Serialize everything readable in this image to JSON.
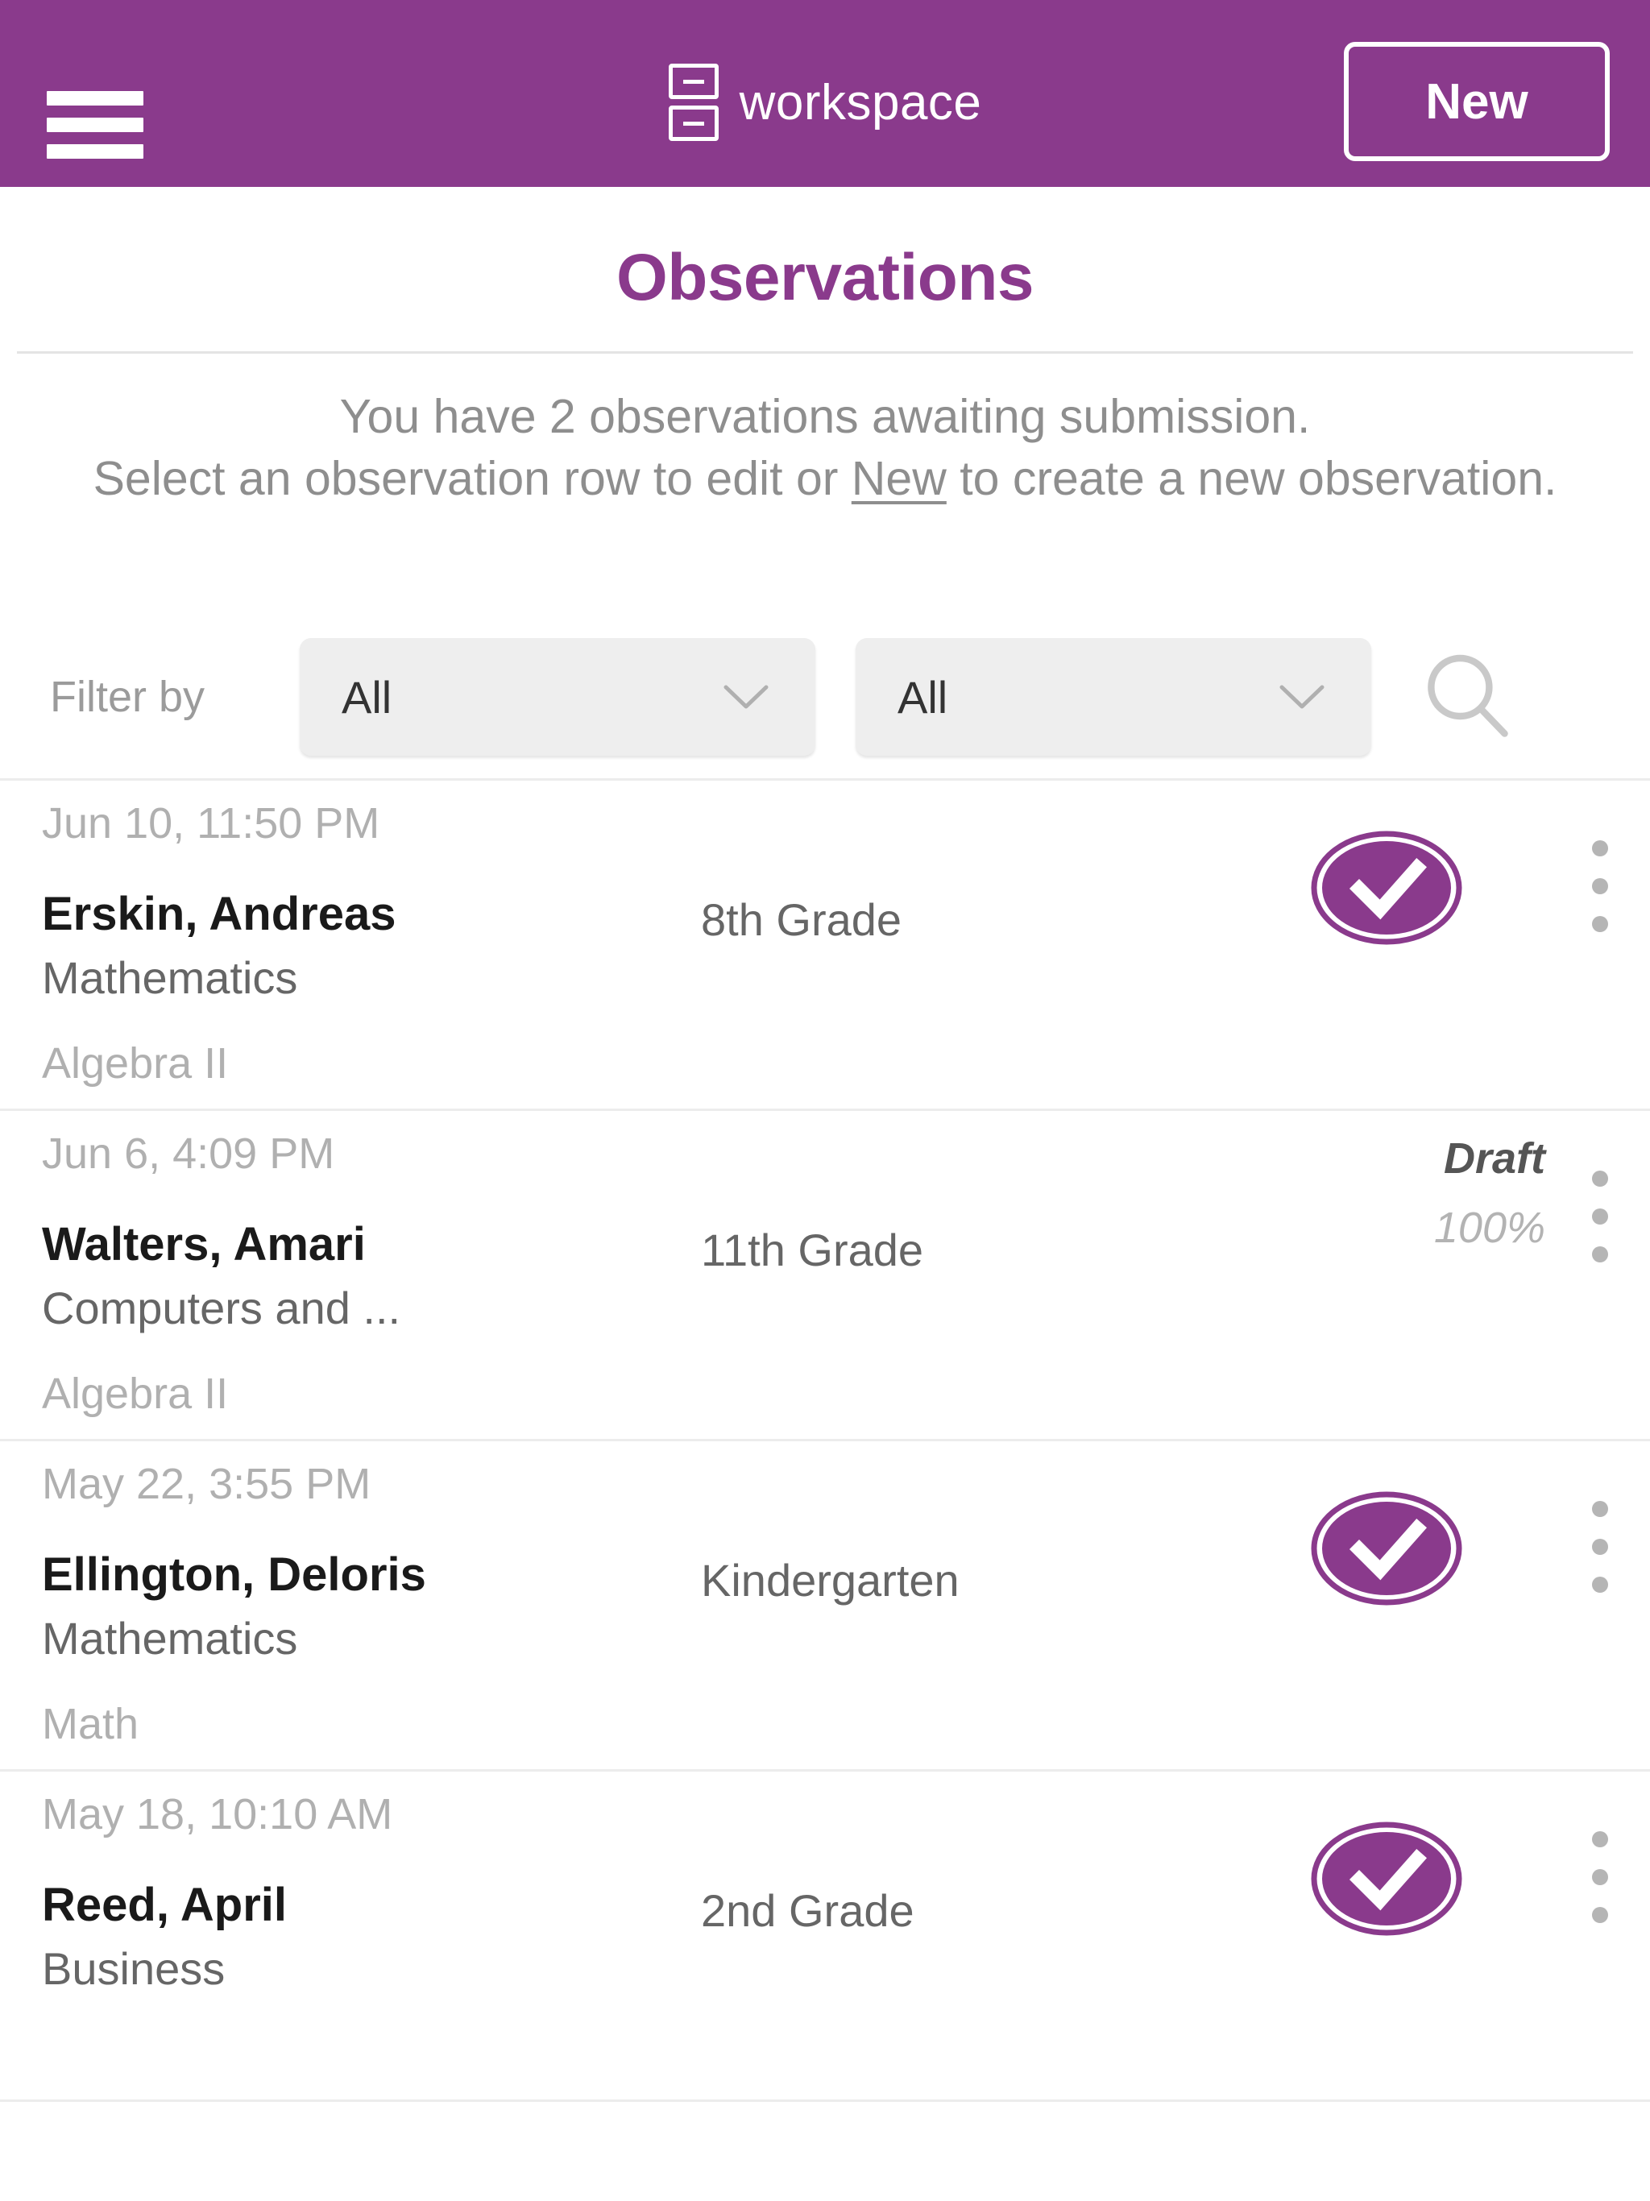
{
  "header": {
    "menu_icon": "hamburger-menu-icon",
    "logo_icon": "workspace-drawers-icon",
    "brand": "workspace",
    "new_button": "New",
    "background_color": "#8a3a8c"
  },
  "page": {
    "title": "Observations",
    "title_color": "#8a3a8c",
    "intro_line1": "You have 2 observations awaiting submission.",
    "intro_line2_pre": "Select an observation row to edit or ",
    "intro_link": "New",
    "intro_line2_post": " to create a new observation."
  },
  "filter": {
    "label": "Filter by",
    "select1_value": "All",
    "select2_value": "All",
    "chevron_icon": "chevron-down-icon",
    "search_icon": "search-icon"
  },
  "observations": [
    {
      "date": "Jun 10, 11:50 PM",
      "name": "Erskin, Andreas",
      "subject": "Mathematics",
      "course": "Algebra II",
      "grade": "8th Grade",
      "status_icon": "check-circle-icon",
      "status_label": "",
      "status_percent": "",
      "menu_icon": "kebab-menu-icon"
    },
    {
      "date": "Jun 6, 4:09 PM",
      "name": "Walters, Amari",
      "subject": "Computers and ...",
      "course": "Algebra II",
      "grade": "11th Grade",
      "status_icon": "",
      "status_label": "Draft",
      "status_percent": "100%",
      "menu_icon": "kebab-menu-icon"
    },
    {
      "date": "May 22, 3:55 PM",
      "name": "Ellington, Deloris",
      "subject": "Mathematics",
      "course": "Math",
      "grade": "Kindergarten",
      "status_icon": "check-circle-icon",
      "status_label": "",
      "status_percent": "",
      "menu_icon": "kebab-menu-icon"
    },
    {
      "date": "May 18, 10:10 AM",
      "name": "Reed, April",
      "subject": "Business",
      "course": "",
      "grade": "2nd Grade",
      "status_icon": "check-circle-icon",
      "status_label": "",
      "status_percent": "",
      "menu_icon": "kebab-menu-icon"
    }
  ]
}
